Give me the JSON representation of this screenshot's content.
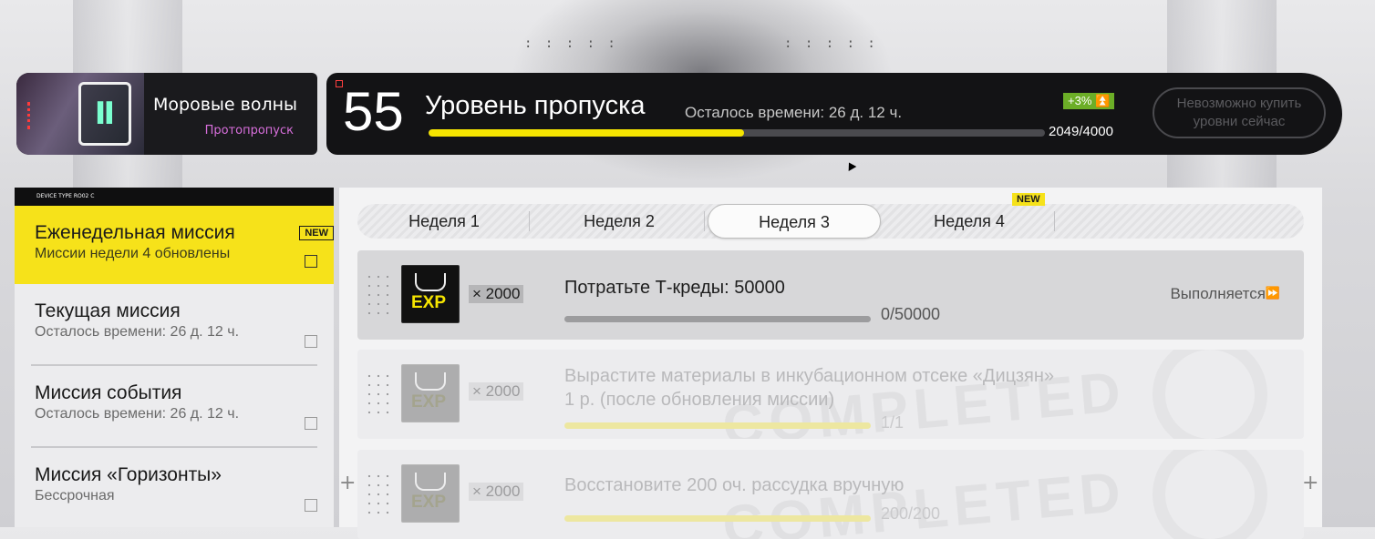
{
  "season": {
    "title": "Моровые волны",
    "subtitle": "Протопропуск"
  },
  "pass": {
    "level": "55",
    "level_label": "Уровень пропуска",
    "time_left": "Осталось времени: 26 д. 12 ч.",
    "xp_bonus": "+3% ⏫",
    "xp_value": "2049/4000",
    "xp_progress": 0.512,
    "buy_button": "Невозможно купить уровни сейчас"
  },
  "menu": {
    "header_text": "DEVICE TYPE RO02 C",
    "new_label": "NEW",
    "items": [
      {
        "title": "Еженедельная миссия",
        "subtitle": "Миссии недели 4 обновлены"
      },
      {
        "title": "Текущая миссия",
        "subtitle": "Осталось времени: 26 д. 12 ч."
      },
      {
        "title": "Миссия события",
        "subtitle": "Осталось времени: 26 д. 12 ч."
      },
      {
        "title": "Миссия «Горизонты»",
        "subtitle": "Бессрочная"
      }
    ]
  },
  "tabs": {
    "new_label": "NEW",
    "items": [
      "Неделя 1",
      "Неделя 2",
      "Неделя 3",
      "Неделя 4"
    ],
    "active_index": 2
  },
  "missions": [
    {
      "reward_icon": "EXP",
      "reward_qty": "× 2000",
      "description": "Потратьте Т-креды: 50000",
      "progress_text": "0/50000",
      "progress": 0,
      "status": "Выполняется"
    },
    {
      "reward_icon": "EXP",
      "reward_qty": "× 2000",
      "description": "Вырастите материалы в инкубационном отсеке «Дицзян» 1 р. (после обновления миссии)",
      "progress_text": "1/1",
      "progress": 1
    },
    {
      "reward_icon": "EXP",
      "reward_qty": "× 2000",
      "description": "Восстановите 200 оч. рассудка вручную",
      "progress_text": "200/200",
      "progress": 1
    }
  ],
  "stamp_text": "COMPLETED"
}
